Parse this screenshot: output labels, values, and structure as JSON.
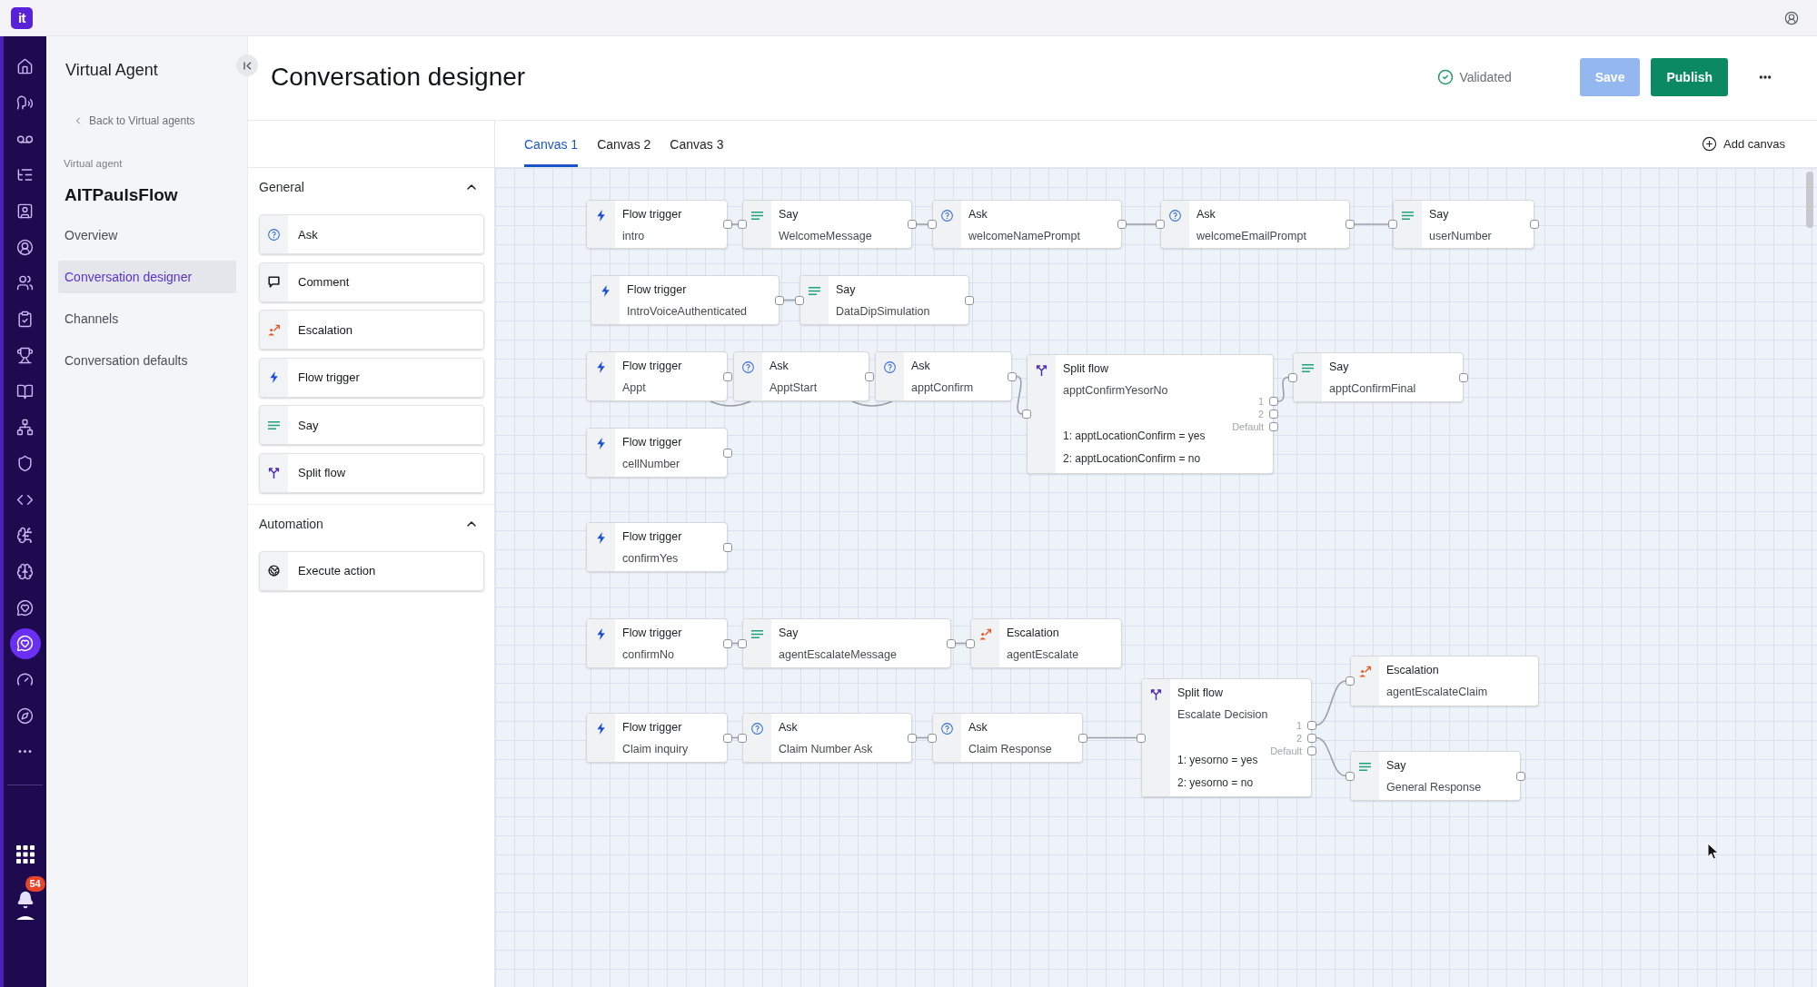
{
  "top_bar": {
    "logo": "it"
  },
  "nav_rail": {
    "items": [
      {
        "selected": false
      },
      {
        "selected": false
      },
      {
        "selected": false
      },
      {
        "selected": false
      },
      {
        "selected": false
      },
      {
        "selected": false
      },
      {
        "selected": false
      },
      {
        "selected": false
      },
      {
        "selected": false
      },
      {
        "selected": false
      },
      {
        "selected": false
      },
      {
        "selected": false
      },
      {
        "selected": false
      },
      {
        "selected": false
      },
      {
        "selected": false
      },
      {
        "selected": false
      },
      {
        "selected": true
      },
      {
        "selected": false
      },
      {
        "selected": false
      },
      {
        "selected": false
      }
    ]
  },
  "notifications": {
    "count": "54"
  },
  "sidebar": {
    "title": "Virtual Agent",
    "back_link": "Back to Virtual agents",
    "section_label": "Virtual agent",
    "agent_name": "AITPaulsFlow",
    "items": [
      {
        "label": "Overview",
        "selected": false
      },
      {
        "label": "Conversation designer",
        "selected": true
      },
      {
        "label": "Channels",
        "selected": false
      },
      {
        "label": "Conversation defaults",
        "selected": false
      }
    ]
  },
  "header": {
    "title": "Conversation designer",
    "status": {
      "label": "Validated",
      "valid": true
    },
    "buttons": [
      {
        "kind": "save",
        "label": "Save",
        "disabled": true
      },
      {
        "kind": "publish",
        "label": "Publish",
        "disabled": false
      }
    ]
  },
  "palette": {
    "sections": [
      {
        "title": "General",
        "expanded": true,
        "items": [
          {
            "kind": "ask",
            "label": "Ask"
          },
          {
            "kind": "comment",
            "label": "Comment"
          },
          {
            "kind": "escalation",
            "label": "Escalation"
          },
          {
            "kind": "flow_trigger",
            "label": "Flow trigger"
          },
          {
            "kind": "say",
            "label": "Say"
          },
          {
            "kind": "split_flow",
            "label": "Split flow"
          }
        ]
      },
      {
        "title": "Automation",
        "expanded": true,
        "items": [
          {
            "kind": "execute_action",
            "label": "Execute action"
          }
        ]
      }
    ]
  },
  "canvas_tabs": {
    "tabs": [
      {
        "label": "Canvas 1",
        "selected": true
      },
      {
        "label": "Canvas 2",
        "selected": false
      },
      {
        "label": "Canvas 3",
        "selected": false
      }
    ],
    "add_label": "Add canvas"
  },
  "canvas": {
    "nodes": [
      {
        "kind": "flow_trigger",
        "title": "Flow trigger",
        "name": "intro"
      },
      {
        "kind": "say",
        "title": "Say",
        "name": "WelcomeMessage"
      },
      {
        "kind": "ask",
        "title": "Ask",
        "name": "welcomeNamePrompt"
      },
      {
        "kind": "ask",
        "title": "Ask",
        "name": "welcomeEmailPrompt"
      },
      {
        "kind": "say",
        "title": "Say",
        "name": "userNumber"
      },
      {
        "kind": "flow_trigger",
        "title": "Flow trigger",
        "name": "IntroVoiceAuthenticated"
      },
      {
        "kind": "say",
        "title": "Say",
        "name": "DataDipSimulation"
      },
      {
        "kind": "flow_trigger",
        "title": "Flow trigger",
        "name": "Appt"
      },
      {
        "kind": "ask",
        "title": "Ask",
        "name": "ApptStart"
      },
      {
        "kind": "ask",
        "title": "Ask",
        "name": "apptConfirm"
      },
      {
        "kind": "split_flow",
        "title": "Split flow",
        "name": "apptConfirmYesorNo",
        "outputs": [
          "1",
          "2",
          "Default"
        ],
        "conditions": [
          "1: apptLocationConfirm = yes",
          "2: apptLocationConfirm = no"
        ]
      },
      {
        "kind": "say",
        "title": "Say",
        "name": "apptConfirmFinal"
      },
      {
        "kind": "flow_trigger",
        "title": "Flow trigger",
        "name": "cellNumber"
      },
      {
        "kind": "flow_trigger",
        "title": "Flow trigger",
        "name": "confirmYes"
      },
      {
        "kind": "flow_trigger",
        "title": "Flow trigger",
        "name": "confirmNo"
      },
      {
        "kind": "say",
        "title": "Say",
        "name": "agentEscalateMessage"
      },
      {
        "kind": "escalation",
        "title": "Escalation",
        "name": "agentEscalate"
      },
      {
        "kind": "flow_trigger",
        "title": "Flow trigger",
        "name": "Claim inquiry"
      },
      {
        "kind": "ask",
        "title": "Ask",
        "name": "Claim Number Ask"
      },
      {
        "kind": "ask",
        "title": "Ask",
        "name": "Claim Response"
      },
      {
        "kind": "split_flow",
        "title": "Split flow",
        "name": "Escalate Decision",
        "outputs": [
          "1",
          "2",
          "Default"
        ],
        "conditions": [
          "1: yesorno = yes",
          "2: yesorno = no"
        ]
      },
      {
        "kind": "escalation",
        "title": "Escalation",
        "name": "agentEscalateClaim"
      },
      {
        "kind": "say",
        "title": "Say",
        "name": "General Response"
      }
    ]
  }
}
